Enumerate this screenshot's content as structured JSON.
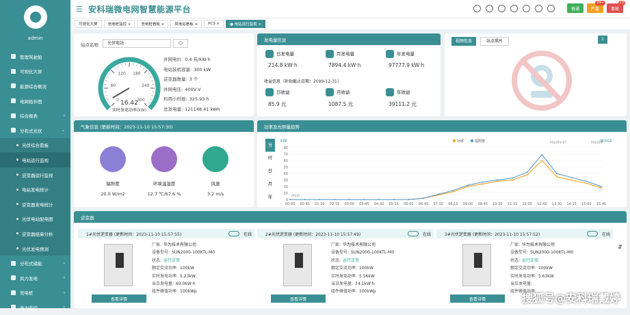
{
  "user": "admin",
  "menu": [
    {
      "label": "管理驾驶舱",
      "type": "top"
    },
    {
      "label": "可视化大屏",
      "type": "top"
    },
    {
      "label": "能源综合概况",
      "type": "top"
    },
    {
      "label": "电网拓扑图",
      "type": "top"
    },
    {
      "label": "综合报表",
      "type": "top",
      "arrow": "‹"
    },
    {
      "label": "分布式光伏",
      "type": "top",
      "arrow": "⌄"
    },
    {
      "label": "光伏综合看板",
      "type": "sub"
    },
    {
      "label": "电站运行监视",
      "type": "sub",
      "active": true
    },
    {
      "label": "逆变器运行监视",
      "type": "sub"
    },
    {
      "label": "电站发电统计",
      "type": "sub"
    },
    {
      "label": "逆变器发电统计",
      "type": "sub"
    },
    {
      "label": "光伏电站配电图",
      "type": "sub"
    },
    {
      "label": "逆变器组串分析",
      "type": "sub"
    },
    {
      "label": "光伏发电预测",
      "type": "sub"
    },
    {
      "label": "分布式储能",
      "type": "top",
      "arrow": "‹"
    },
    {
      "label": "风力发电",
      "type": "top",
      "arrow": "‹"
    },
    {
      "label": "充电桩",
      "type": "top",
      "arrow": "‹"
    },
    {
      "label": "电力监控",
      "type": "top",
      "arrow": "‹"
    }
  ],
  "title": "安科瑞微电网智慧能源平台",
  "top_buttons": [
    {
      "label": "普通",
      "color": "#3fae5a",
      "badge": ""
    },
    {
      "label": "严重",
      "color": "#f0a020",
      "badge": "99+"
    },
    {
      "label": "事故",
      "color": "#e05050",
      "badge": "13"
    }
  ],
  "tabs": [
    "可视化大屏",
    "充电桩监控 ×",
    "充电桩看板 ×",
    "风电站看板 ×",
    "PCS ×",
    "● 电站运行监视 ×"
  ],
  "station": {
    "name_label": "站点名称",
    "name_value": "光伏电站",
    "gauge_value": "16.42",
    "gauge_label": "实时发电功率(kW)",
    "gauge_ticks": [
      "0",
      "60",
      "120",
      "180",
      "240",
      "300"
    ],
    "fields": [
      {
        "l": "并网电价:",
        "v": "0.4 元/kW·h"
      },
      {
        "l": "电站装机容量:",
        "v": "300 kW"
      },
      {
        "l": "逆变器数量:",
        "v": "3 个"
      },
      {
        "l": "并网电压:",
        "v": "400V V"
      },
      {
        "l": "利用小时数:",
        "v": "325.93 h"
      },
      {
        "l": "总发电量:",
        "v": "121148.41 kWh"
      }
    ]
  },
  "gen": {
    "head": "发电量信息",
    "items": [
      {
        "l": "日发电量",
        "v": "214.8 kW·h"
      },
      {
        "l": "月发电量",
        "v": "7894.4 kW·h"
      },
      {
        "l": "年发电量",
        "v": "97777.9 kW·h"
      }
    ],
    "income_label": "收益信息（补贴截止日期：2099-12-31）",
    "income": [
      {
        "l": "日收益",
        "v": "85.9 元"
      },
      {
        "l": "月收益",
        "v": "1087.5 元"
      },
      {
        "l": "年收益",
        "v": "39111.2 元"
      }
    ]
  },
  "video": {
    "tab1": "视频信息",
    "tab2": "站点照片",
    "page": "1"
  },
  "weather": {
    "head": "气象信息 (更新时间：2023-11-10 15:57:30)",
    "items": [
      {
        "l": "辐照度",
        "v": "20.0 W/m2",
        "c": "#8c7fd6",
        "icon": "solar-panel-icon"
      },
      {
        "l": "环境温湿度",
        "v": "12.7 ℃/67.6 %",
        "c": "#9b6fc7",
        "icon": "thermometer-icon"
      },
      {
        "l": "风速",
        "v": "3.2 m/s",
        "c": "#2fa88f",
        "icon": "wind-icon"
      }
    ]
  },
  "chart_head": "功率及光照量趋势",
  "chart_tabs": [
    "分",
    "时",
    "日",
    "月",
    "年"
  ],
  "chart_data": {
    "type": "line",
    "xlabel": "",
    "ylabel": "kW",
    "y2label": "W/m2",
    "x": [
      "00:00",
      "00:45",
      "01:30",
      "02:15",
      "03:00",
      "03:45",
      "04:30",
      "05:15",
      "06:00",
      "06:45",
      "07:30",
      "08:15",
      "09:00",
      "09:45",
      "10:30",
      "11:15",
      "12:00",
      "12:45",
      "13:30",
      "14:15",
      "15:00",
      "15:45"
    ],
    "legend": [
      "功率",
      "辐照度"
    ],
    "ylim": [
      0,
      80
    ],
    "yticks": [
      "0",
      "10",
      "20",
      "30",
      "40",
      "50",
      "60",
      "70",
      "80"
    ],
    "series": [
      {
        "name": "功率",
        "color": "#f39c12",
        "values": [
          0,
          0,
          0,
          0,
          0,
          0,
          0,
          0,
          0,
          2,
          7,
          12,
          20,
          24,
          28,
          30,
          38,
          60,
          35,
          30,
          25,
          18
        ]
      },
      {
        "name": "辐照度",
        "color": "#4a90c2",
        "values": [
          0,
          0,
          0,
          0,
          0,
          0,
          0,
          0,
          0,
          2,
          8,
          14,
          22,
          27,
          30,
          33,
          42,
          69,
          40,
          34,
          28,
          20
        ]
      }
    ],
    "annotations": [
      "Max69.97",
      "Max69",
      "Min0"
    ]
  },
  "inverter_head": "逆变器",
  "inverters": [
    {
      "title": "1#光伏逆变器 (更新时间：2023-11-10 15:57:55)",
      "status": "在线",
      "vendor": "华为技术有限公司",
      "model": "SUN2000-100KTL-M0",
      "state": "运行正常",
      "rated": "100kW",
      "realtime": "5.23kW",
      "daily": "69.0kW·h",
      "cap": "100kWp"
    },
    {
      "title": "2#光伏逆变器 (更新时间：2023-11-10 15:57:49)",
      "status": "在线",
      "vendor": "华为技术有限公司",
      "model": "SUN2000-100KTL-M0",
      "state": "运行正常",
      "rated": "100kW",
      "realtime": "5.56kW",
      "daily": "74.1kW·h",
      "cap": "100kWp"
    },
    {
      "title": "3#光伏逆变器 (更新时间：2023-11-10 15:57:52)",
      "status": "在线",
      "vendor": "华为技术有限公司",
      "model": "SUN2000-100KTL-M0",
      "state": "运行正常",
      "rated": "100kW",
      "realtime": "5.63kW",
      "daily": "",
      "cap": ""
    }
  ],
  "inv_labels": {
    "vendor": "厂家:",
    "model": "设备型号:",
    "state": "状态:",
    "rated": "额定交流功率:",
    "realtime": "实时发电功率:",
    "daily": "当日发电量:",
    "cap": "组件峰值功率:",
    "detail": "查看详情"
  },
  "watermark": "搜狐号@安科瑞戴婷"
}
